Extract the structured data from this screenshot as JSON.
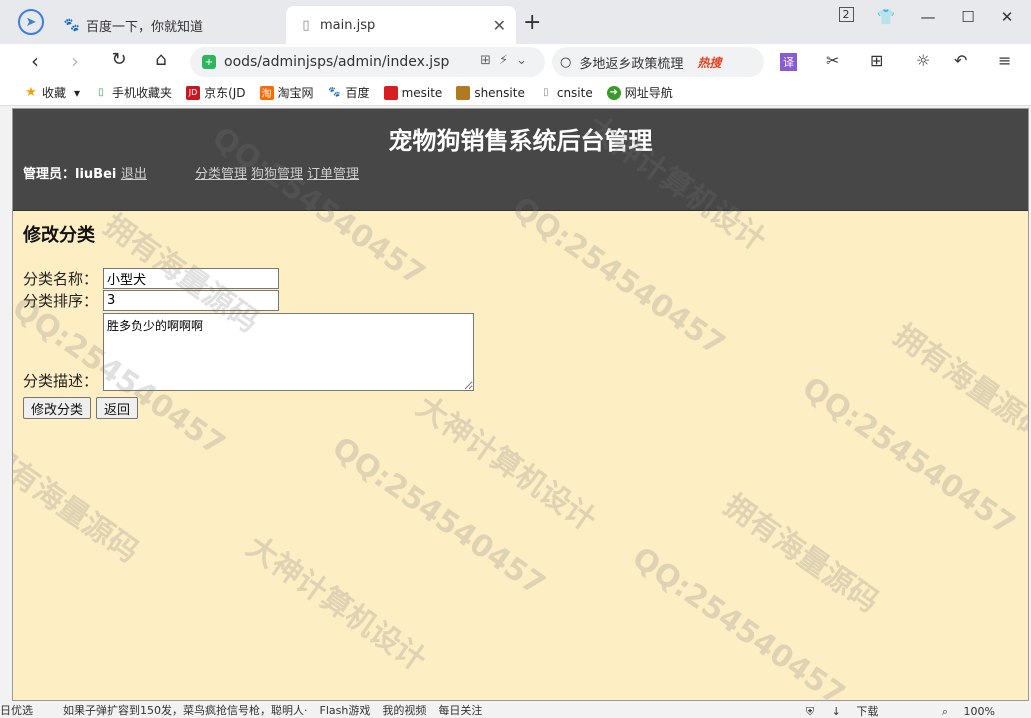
{
  "browser": {
    "tabs": [
      {
        "title": "百度一下，你就知道",
        "active": false
      },
      {
        "title": "main.jsp",
        "active": true
      }
    ],
    "url": "oods/adminjsps/admin/index.jsp",
    "search_text": "多地返乡政策梳理",
    "search_hot": "热搜",
    "tab_count": "2",
    "bookmarks": [
      "收藏",
      "手机收藏夹",
      "京东(JD",
      "淘宝网",
      "百度",
      "mesite",
      "shensite",
      "cnsite",
      "网址导航"
    ],
    "translate_label": "译",
    "jd_badge": "JD"
  },
  "page": {
    "site_title": "宠物狗销售系统后台管理",
    "admin_label": "管理员：",
    "admin_name": "liuBei",
    "logout": "退出",
    "menu": [
      "分类管理",
      "狗狗管理",
      "订单管理"
    ],
    "heading": "修改分类",
    "form": {
      "name_label": "分类名称：",
      "name_value": "小型犬",
      "order_label": "分类排序：",
      "order_value": "3",
      "desc_label": "分类描述：",
      "desc_value": "胜多负少的啊啊啊",
      "submit": "修改分类",
      "back": "返回"
    }
  },
  "watermarks": [
    "QQ:254540457",
    "大神计算机设计",
    "拥有海量源码"
  ],
  "statusbar": {
    "items": [
      "日优选",
      "如果子弹扩容到150发，菜鸟疯抢信号枪，聪明人·",
      "Flash游戏",
      "我的视频",
      "每日关注"
    ],
    "download": "下载",
    "zoom": "100%"
  }
}
